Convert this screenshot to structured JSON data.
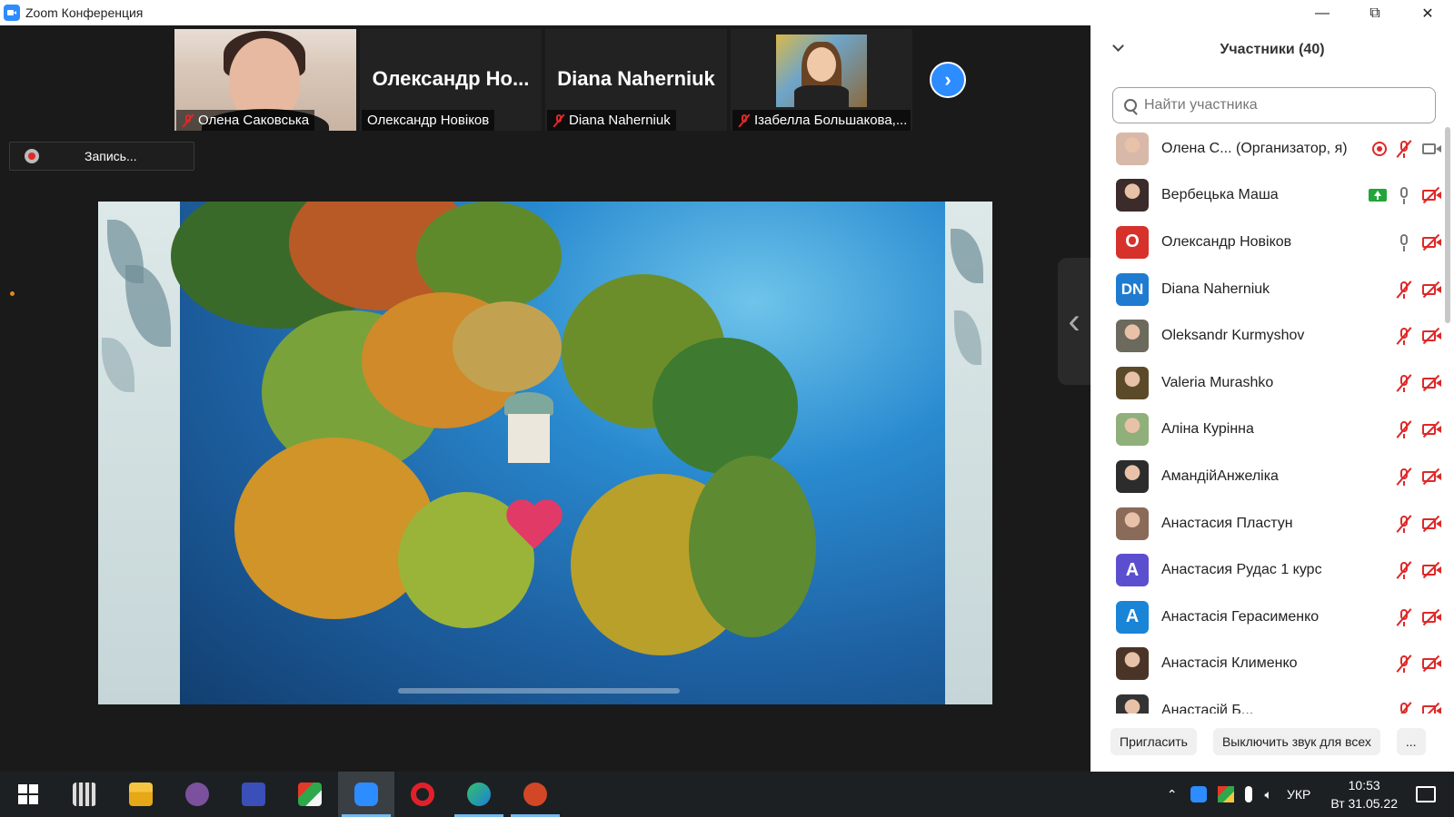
{
  "window": {
    "title": "Zoom Конференция"
  },
  "strip": {
    "tiles": [
      {
        "name": "Олена Саковська",
        "muted": true
      },
      {
        "big_name": "Олександр Но...",
        "name": "Олександр Новіков",
        "muted": false
      },
      {
        "big_name": "Diana Naherniuk",
        "name": "Diana Naherniuk",
        "muted": true
      },
      {
        "name": "Ізабелла Большакова,...",
        "muted": true
      }
    ]
  },
  "record": {
    "label": "Запись..."
  },
  "panel": {
    "title": "Участники (40)",
    "search": {
      "placeholder": "Найти участника",
      "value": ""
    },
    "participants": [
      {
        "name": "Олена С...  (Организатор, я)",
        "avatar": "photo",
        "avatar_color": "#d8b8a8",
        "mic": "off",
        "cam": "on",
        "recording": true
      },
      {
        "name": "Вербецька Маша",
        "avatar": "photo",
        "avatar_color": "#3b2b2b",
        "mic": "on",
        "cam": "off",
        "sharing": true
      },
      {
        "name": "Олександр Новіков",
        "avatar": "O",
        "avatar_color": "#d7312b",
        "mic": "on",
        "cam": "off"
      },
      {
        "name": "Diana Naherniuk",
        "avatar": "DN",
        "avatar_color": "#1e7bd0",
        "mic": "off",
        "cam": "off"
      },
      {
        "name": "Oleksandr Kurmyshov",
        "avatar": "photo",
        "avatar_color": "#6b6a5c",
        "mic": "off",
        "cam": "off"
      },
      {
        "name": "Valeria Murashko",
        "avatar": "photo",
        "avatar_color": "#5b4a2a",
        "mic": "off",
        "cam": "off"
      },
      {
        "name": "Аліна Курінна",
        "avatar": "photo",
        "avatar_color": "#8fb07a",
        "mic": "off",
        "cam": "off"
      },
      {
        "name": "АмандійАнжеліка",
        "avatar": "photo",
        "avatar_color": "#2c2c2c",
        "mic": "off",
        "cam": "off"
      },
      {
        "name": "Анастасия Пластун",
        "avatar": "photo",
        "avatar_color": "#8a6a58",
        "mic": "off",
        "cam": "off"
      },
      {
        "name": "Анастасия Рудас 1 курс",
        "avatar": "A",
        "avatar_color": "#5c4fcf",
        "mic": "off",
        "cam": "off"
      },
      {
        "name": "Анастасія Герасименко",
        "avatar": "A",
        "avatar_color": "#1a84d6",
        "mic": "off",
        "cam": "off"
      },
      {
        "name": "Анастасія Клименко",
        "avatar": "photo",
        "avatar_color": "#4a3428",
        "mic": "off",
        "cam": "off"
      },
      {
        "name": "Анастасій Б...",
        "avatar": "photo",
        "avatar_color": "#333333",
        "mic": "off",
        "cam": "off"
      }
    ],
    "buttons": {
      "invite": "Пригласить",
      "mute_all": "Выключить звук для всех",
      "more": "..."
    }
  },
  "taskbar": {
    "apps": [
      "start-icon",
      "calculator-icon",
      "file-explorer-icon",
      "viber-icon",
      "save-icon",
      "app-icon",
      "zoom-icon",
      "opera-icon",
      "edge-icon",
      "powerpoint-icon"
    ],
    "language": "УКР",
    "time": "10:53",
    "date": "Вт 31.05.22"
  },
  "colors": {
    "accent": "#2d8cff",
    "muted": "#e02828",
    "share": "#23a53a"
  }
}
